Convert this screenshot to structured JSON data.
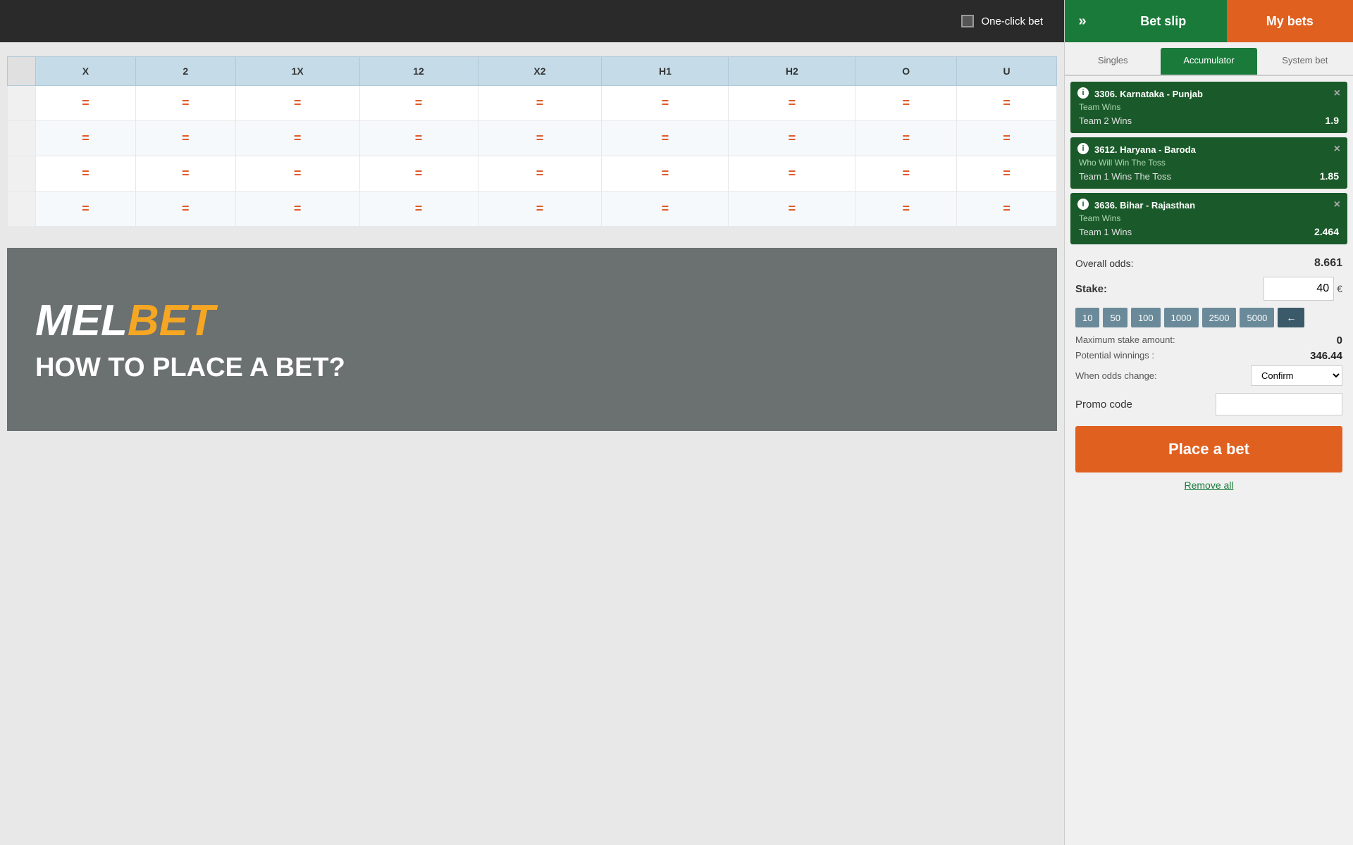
{
  "topbar": {
    "one_click_label": "One-click bet"
  },
  "table": {
    "columns": [
      "X",
      "2",
      "1X",
      "12",
      "X2",
      "H1",
      "H2",
      "O",
      "U"
    ],
    "rows": [
      [
        "=",
        "=",
        "=",
        "=",
        "=",
        "=",
        "=",
        "=",
        "="
      ],
      [
        "=",
        "=",
        "=",
        "=",
        "=",
        "=",
        "=",
        "=",
        "="
      ],
      [
        "=",
        "=",
        "=",
        "=",
        "=",
        "=",
        "=",
        "=",
        "="
      ],
      [
        "=",
        "=",
        "=",
        "=",
        "=",
        "=",
        "=",
        "=",
        "="
      ]
    ]
  },
  "banner": {
    "logo_mel": "MEL",
    "logo_bet": "BET",
    "subtitle": "HOW TO PLACE A BET?"
  },
  "sidebar": {
    "chevron": "»",
    "tab_betslip": "Bet slip",
    "tab_mybets": "My bets",
    "bet_type_singles": "Singles",
    "bet_type_accumulator": "Accumulator",
    "bet_type_system": "System bet",
    "bet_items": [
      {
        "id": "bet1",
        "title": "3306. Karnataka - Punjab",
        "market": "Team Wins",
        "selection": "Team 2 Wins",
        "odds": "1.9"
      },
      {
        "id": "bet2",
        "title": "3612. Haryana - Baroda",
        "market": "Who Will Win The Toss",
        "selection": "Team 1 Wins The Toss",
        "odds": "1.85"
      },
      {
        "id": "bet3",
        "title": "3636. Bihar - Rajasthan",
        "market": "Team Wins",
        "selection": "Team 1 Wins",
        "odds": "2.464"
      }
    ],
    "overall_odds_label": "Overall odds:",
    "overall_odds_value": "8.661",
    "stake_label": "Stake:",
    "stake_value": "40",
    "currency": "€",
    "quick_stakes": [
      "10",
      "50",
      "100",
      "1000",
      "2500",
      "5000"
    ],
    "max_stake_label": "Maximum stake amount:",
    "max_stake_value": "0",
    "potential_winnings_label": "Potential winnings :",
    "potential_winnings_value": "346.44",
    "when_odds_label": "When odds change:",
    "when_odds_value": "Confirm",
    "promo_code_label": "Promo code",
    "promo_placeholder": "",
    "place_bet_label": "Place a bet",
    "remove_all_label": "Remove all"
  }
}
